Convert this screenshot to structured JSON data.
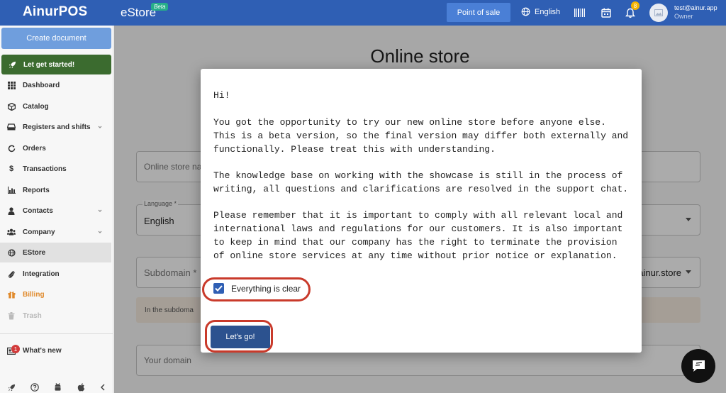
{
  "header": {
    "logo": "AinurPOS",
    "section": "eStore",
    "beta_badge": "Beta",
    "pos_button": "Point of sale",
    "language": "English",
    "notification_count": "8",
    "user_email": "test@ainur.app",
    "user_role": "Owner",
    "colors": {
      "bar": "#2f5fb4",
      "button": "#4a7fd6"
    }
  },
  "sidebar": {
    "create_button": "Create document",
    "get_started": "Let get started!",
    "items": [
      {
        "label": "Dashboard",
        "icon": "grid-icon"
      },
      {
        "label": "Catalog",
        "icon": "box-icon"
      },
      {
        "label": "Registers and shifts",
        "icon": "register-icon"
      },
      {
        "label": "Orders",
        "icon": "refresh-icon"
      },
      {
        "label": "Transactions",
        "icon": "dollar-icon"
      },
      {
        "label": "Reports",
        "icon": "bar-chart-icon"
      },
      {
        "label": "Contacts",
        "icon": "user-icon"
      },
      {
        "label": "Company",
        "icon": "users-icon"
      },
      {
        "label": "EStore",
        "icon": "globe-icon"
      },
      {
        "label": "Integration",
        "icon": "paperclip-icon"
      },
      {
        "label": "Billing",
        "icon": "gift-icon"
      },
      {
        "label": "Trash",
        "icon": "trash-icon"
      }
    ],
    "whats_new": "What's new",
    "whats_new_count": "1"
  },
  "main": {
    "title": "Online store",
    "store_name_placeholder": "Online store na",
    "language_label": "Language *",
    "language_value": "English",
    "subdomain_placeholder": "Subdomain *",
    "subdomain_suffix": "ainur.store",
    "subdomain_note": "In the subdoma",
    "domain_placeholder": "Your domain"
  },
  "modal": {
    "greeting": "Hi!",
    "paragraph1": "You got the opportunity to try our new online store before anyone else. This is a beta version, so the final version may differ both externally and functionally. Please treat this with understanding.",
    "paragraph2": "The knowledge base on working with the showcase is still in the process of writing, all questions and clarifications are resolved in the support chat.",
    "paragraph3": "Please remember that it is important to comply with all relevant local and international laws and regulations for our customers. It is also important to keep in mind that our company has the right to terminate the provision of online store services at any time without prior notice or explanation.",
    "checkbox_label": "Everything is clear",
    "checkbox_checked": true,
    "button_label": "Let's go!",
    "highlight_color": "#c93a2b"
  }
}
